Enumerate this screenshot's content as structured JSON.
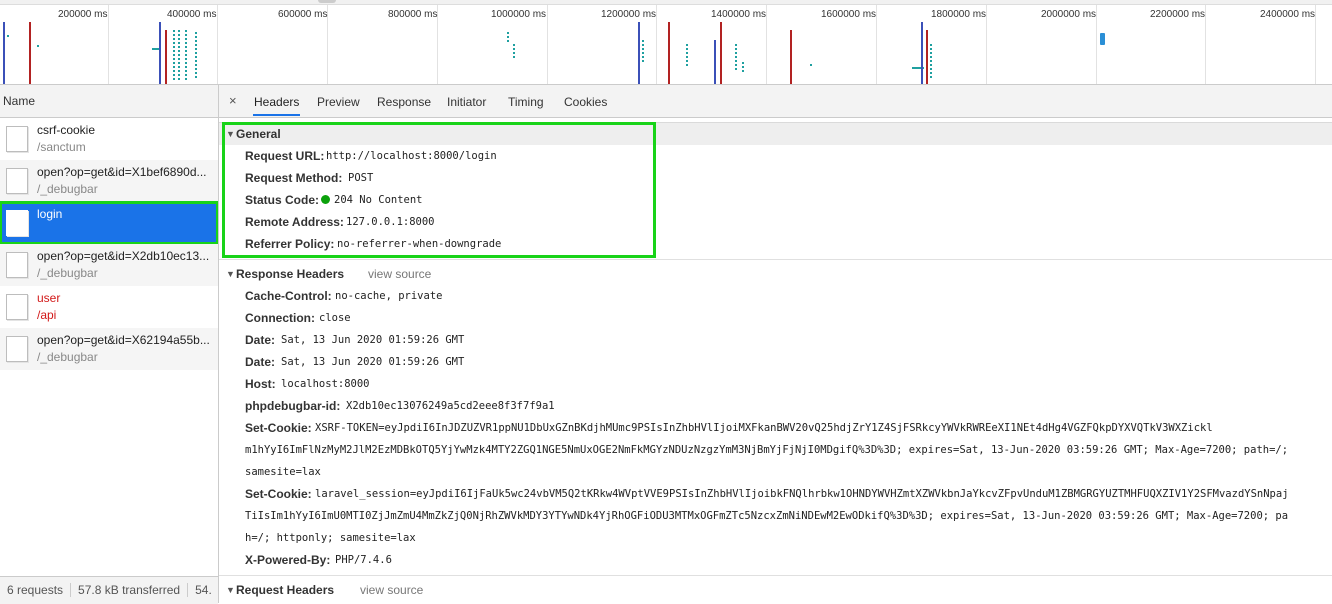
{
  "timeline": {
    "ticks": [
      "200000 ms",
      "400000 ms",
      "600000 ms",
      "800000 ms",
      "1000000 ms",
      "1200000 ms",
      "1400000 ms",
      "1600000 ms",
      "1800000 ms",
      "2000000 ms",
      "2200000 ms",
      "2400000 ms"
    ]
  },
  "list": {
    "header": "Name",
    "requests": [
      {
        "name": "csrf-cookie",
        "path": "/sanctum"
      },
      {
        "name": "open?op=get&id=X1bef6890d...",
        "path": "/_debugbar"
      },
      {
        "name": "login",
        "path": ""
      },
      {
        "name": "open?op=get&id=X2db10ec13...",
        "path": "/_debugbar"
      },
      {
        "name": "user",
        "path": "/api"
      },
      {
        "name": "open?op=get&id=X62194a55b...",
        "path": "/_debugbar"
      }
    ]
  },
  "status_bar": {
    "requests": "6 requests",
    "transferred": "57.8 kB transferred",
    "resources": "54."
  },
  "tabs": {
    "close": "×",
    "items": [
      "Headers",
      "Preview",
      "Response",
      "Initiator",
      "Timing",
      "Cookies"
    ],
    "active": "Headers"
  },
  "general": {
    "title": "General",
    "request_url_k": "Request URL:",
    "request_url_v": "http://localhost:8000/login",
    "request_method_k": "Request Method:",
    "request_method_v": "POST",
    "status_code_k": "Status Code:",
    "status_code_v": "204 No Content",
    "remote_address_k": "Remote Address:",
    "remote_address_v": "127.0.0.1:8000",
    "referrer_policy_k": "Referrer Policy:",
    "referrer_policy_v": "no-referrer-when-downgrade"
  },
  "response_headers": {
    "title": "Response Headers",
    "view_source": "view source",
    "cache_control_k": "Cache-Control:",
    "cache_control_v": "no-cache, private",
    "connection_k": "Connection:",
    "connection_v": "close",
    "date1_k": "Date:",
    "date1_v": "Sat, 13 Jun 2020 01:59:26 GMT",
    "date2_k": "Date:",
    "date2_v": "Sat, 13 Jun 2020 01:59:26 GMT",
    "host_k": "Host:",
    "host_v": "localhost:8000",
    "debugbar_k": "phpdebugbar-id:",
    "debugbar_v": "X2db10ec13076249a5cd2eee8f3f7f9a1",
    "set_cookie1_k": "Set-Cookie:",
    "set_cookie1_v1": "XSRF-TOKEN=eyJpdiI6InJDZUZVR1ppNU1DbUxGZnBKdjhMUmc9PSIsInZhbHVlIjoiMXFkanBWV20vQ25hdjZrY1Z4SjFSRkcyYWVkRWREeXI1NEt4dHg4VGZFQkpDYXVQTkV3WXZickl",
    "set_cookie1_v2": "m1hYyI6ImFlNzMyM2JlM2EzMDBkOTQ5YjYwMzk4MTY2ZGQ1NGE5NmUxOGE2NmFkMGYzNDUzNzgzYmM3NjBmYjFjNjI0MDgifQ%3D%3D; expires=Sat, 13-Jun-2020 03:59:26 GMT; Max-Age=7200; path=/;",
    "set_cookie1_v3": "samesite=lax",
    "set_cookie2_k": "Set-Cookie:",
    "set_cookie2_v1": "laravel_session=eyJpdiI6IjFaUk5wc24vbVM5Q2tKRkw4WVptVVE9PSIsInZhbHVlIjoibkFNQlhrbkw1OHNDYWVHZmtXZWVkbnJaYkcvZFpvUnduM1ZBMGRGYUZTMHFUQXZIV1Y2SFMvazdYSnNpaj",
    "set_cookie2_v2": "TiIsIm1hYyI6ImU0MTI0ZjJmZmU4MmZkZjQ0NjRhZWVkMDY3YTYwNDk4YjRhOGFiODU3MTMxOGFmZTc5NzcxZmNiNDEwM2EwODkifQ%3D%3D; expires=Sat, 13-Jun-2020 03:59:26 GMT; Max-Age=7200; pa",
    "set_cookie2_v3": "h=/; httponly; samesite=lax",
    "powered_k": "X-Powered-By:",
    "powered_v": "PHP/7.4.6"
  },
  "request_headers": {
    "title": "Request Headers",
    "view_source": "view source"
  },
  "colors": {
    "selected": "#1a73e8",
    "highlight_box": "#18d318",
    "status_ok": "#0ca10c",
    "error_text": "#d21919"
  }
}
